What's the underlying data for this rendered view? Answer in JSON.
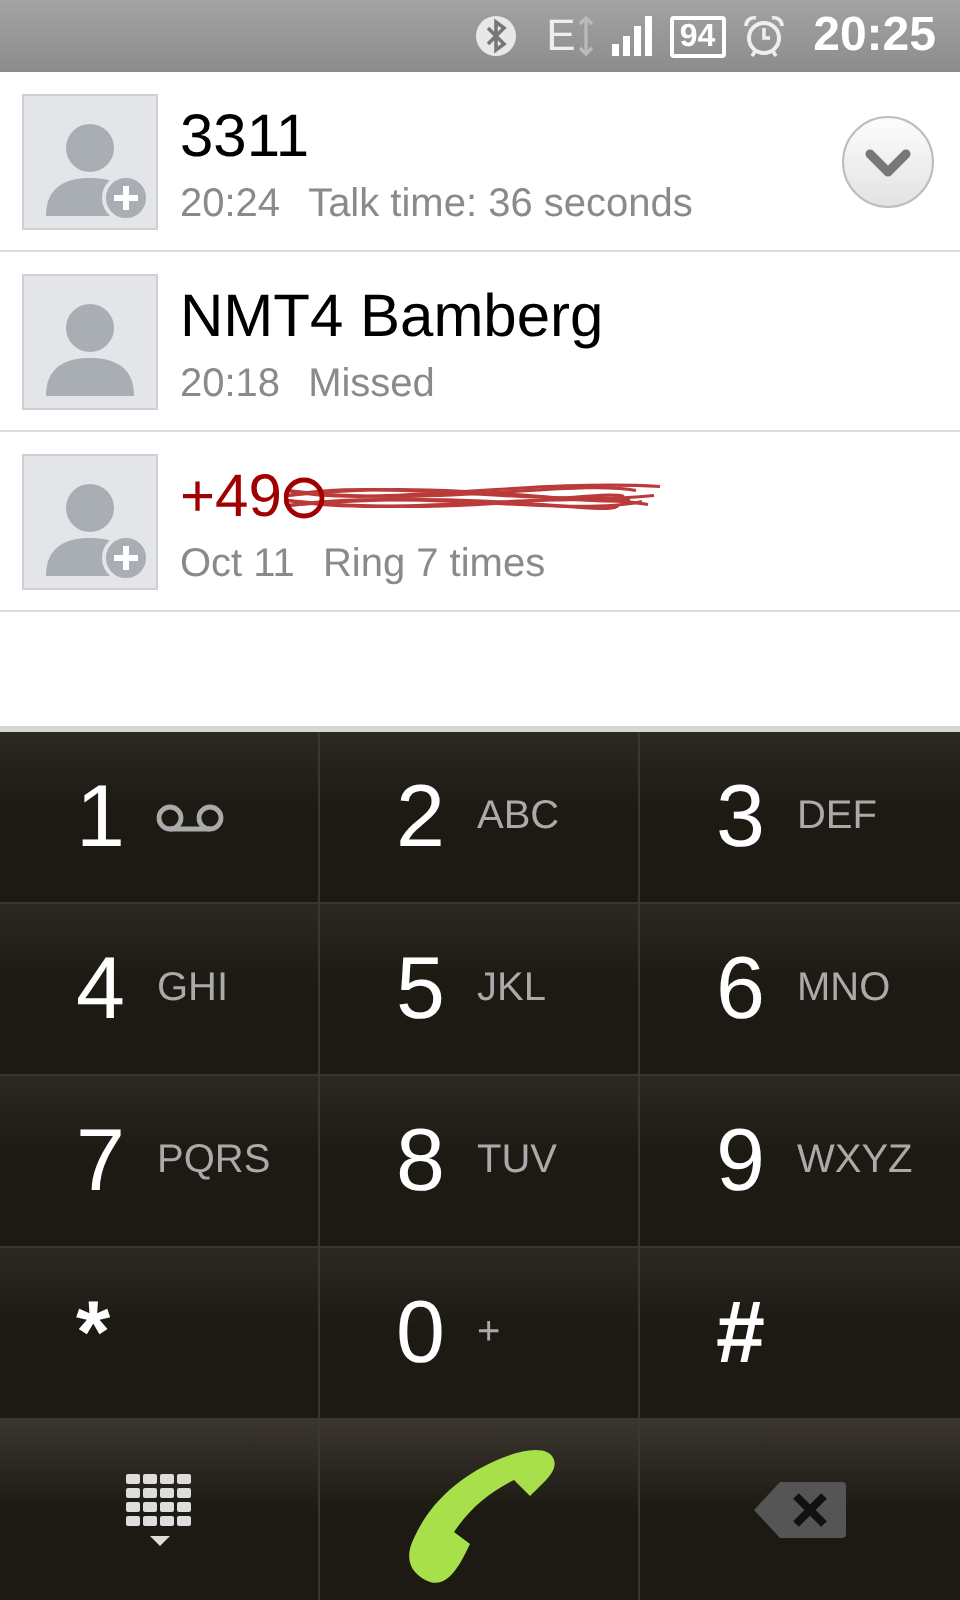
{
  "status_bar": {
    "network": "E",
    "battery": "94",
    "time": "20:25"
  },
  "calls": [
    {
      "name": "3311",
      "time": "20:24",
      "detail": "Talk time: 36 seconds",
      "color": "#000000",
      "add_contact": true,
      "actions_button": true,
      "redacted": false
    },
    {
      "name": "NMT4 Bamberg",
      "time": "20:18",
      "detail": "Missed",
      "color": "#000000",
      "add_contact": false,
      "actions_button": false,
      "redacted": false
    },
    {
      "name": "+49",
      "time": "Oct 11",
      "detail": "Ring 7 times",
      "color": "#a00000",
      "add_contact": true,
      "actions_button": false,
      "redacted": true
    }
  ],
  "keypad": [
    {
      "digit": "1",
      "kind": "voicemail"
    },
    {
      "digit": "2",
      "kind": "letters",
      "letters": "ABC"
    },
    {
      "digit": "3",
      "kind": "letters",
      "letters": "DEF"
    },
    {
      "digit": "4",
      "kind": "letters",
      "letters": "GHI"
    },
    {
      "digit": "5",
      "kind": "letters",
      "letters": "JKL"
    },
    {
      "digit": "6",
      "kind": "letters",
      "letters": "MNO"
    },
    {
      "digit": "7",
      "kind": "letters",
      "letters": "PQRS"
    },
    {
      "digit": "8",
      "kind": "letters",
      "letters": "TUV"
    },
    {
      "digit": "9",
      "kind": "letters",
      "letters": "WXYZ"
    },
    {
      "digit": "*",
      "kind": "symbol"
    },
    {
      "digit": "0",
      "kind": "letters",
      "letters": "+"
    },
    {
      "digit": "#",
      "kind": "symbol"
    }
  ]
}
